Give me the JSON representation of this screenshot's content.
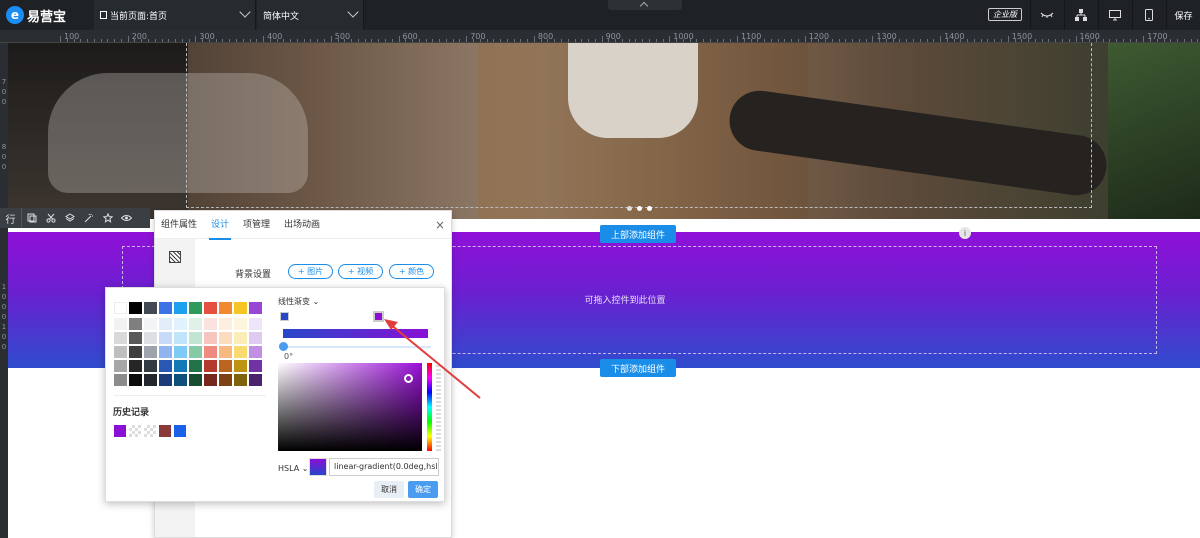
{
  "app": {
    "logo_text": "易营宝",
    "logo_glyph": "e"
  },
  "topbar": {
    "current_page": "当前页面:首页",
    "language": "简体中文",
    "edition_badge": "企业版",
    "save_label": "保存",
    "icons": [
      "preview-eye-icon",
      "sitemap-icon",
      "desktop-icon",
      "mobile-icon"
    ]
  },
  "ruler": {
    "ticks": [
      "100",
      "200",
      "300",
      "400",
      "500",
      "600",
      "700",
      "800",
      "900",
      "1000",
      "1100",
      "1200",
      "1300",
      "1400",
      "1500",
      "1600",
      "1700"
    ]
  },
  "vruler": {
    "ticks": [
      "7",
      "0",
      "0",
      "8",
      "0",
      "0",
      "1",
      "0",
      "0",
      "0",
      "1",
      "0",
      "0"
    ]
  },
  "edit_toolbar": {
    "row_label": "行",
    "icons": [
      "copy-icon",
      "scissors-icon",
      "layers-icon",
      "magic-icon",
      "star-icon",
      "eye-icon"
    ]
  },
  "canvas": {
    "add_above": "上部添加组件",
    "add_below": "下部添加组件",
    "drop_hint": "可拖入控件到此位置",
    "info_glyph": "i"
  },
  "panel": {
    "tabs": [
      "组件属性",
      "设计",
      "项管理",
      "出场动画"
    ],
    "active_tab": 1,
    "close": "×",
    "bg_label": "背景设置",
    "bg_buttons": [
      "+ 图片",
      "+ 视频",
      "+ 颜色"
    ]
  },
  "picker": {
    "gradient_mode": "线性渐变 ⌄",
    "angle": "0°",
    "history_label": "历史记录",
    "color_mode": "HSLA ⌄",
    "value": "linear-gradient(0.0deg,hsl",
    "cancel": "取消",
    "confirm": "确定",
    "top_row": [
      "#ffffff",
      "#000000",
      "#434a54",
      "#3b73e6",
      "#1da0f0",
      "#2f9a5c",
      "#e4503d",
      "#f0892f",
      "#f5c425",
      "#9747d3"
    ],
    "grid": [
      [
        "#f2f2f2",
        "#7f7f7f",
        "#f3f4f6",
        "#e3ecfb",
        "#dff2fd",
        "#e0f2e8",
        "#fbe2df",
        "#fdeedf",
        "#fdf6dc",
        "#efe5f8"
      ],
      [
        "#d9d9d9",
        "#595959",
        "#dcdfe3",
        "#c7daf7",
        "#bfe5fa",
        "#c1e5d2",
        "#f7c5bf",
        "#fbdcbf",
        "#fcedb8",
        "#dfcbf1"
      ],
      [
        "#bfbfbf",
        "#3f3f3f",
        "#9ea4ad",
        "#8fb4ef",
        "#7fcaf5",
        "#84cba5",
        "#ef8b7e",
        "#f7b980",
        "#f9db72",
        "#c08fe4"
      ],
      [
        "#a6a6a6",
        "#262626",
        "#333a42",
        "#2a58b5",
        "#1579b7",
        "#237348",
        "#b33a2c",
        "#bb6520",
        "#be9512",
        "#7133a4"
      ],
      [
        "#8c8c8c",
        "#0c0c0c",
        "#22272d",
        "#1c3b78",
        "#0e507a",
        "#174d30",
        "#77271d",
        "#7d4315",
        "#7f630c",
        "#4b226d"
      ]
    ],
    "history": [
      "#8a10d6",
      "checker",
      "checker",
      "#8b3a3a",
      "#1a60e8"
    ]
  },
  "colors": {
    "accent": "#1a8de9",
    "topbar": "#1e2226",
    "gradient_start": "#2747c9",
    "gradient_end": "#8a10d6",
    "annotation_arrow": "#e23d3d"
  }
}
